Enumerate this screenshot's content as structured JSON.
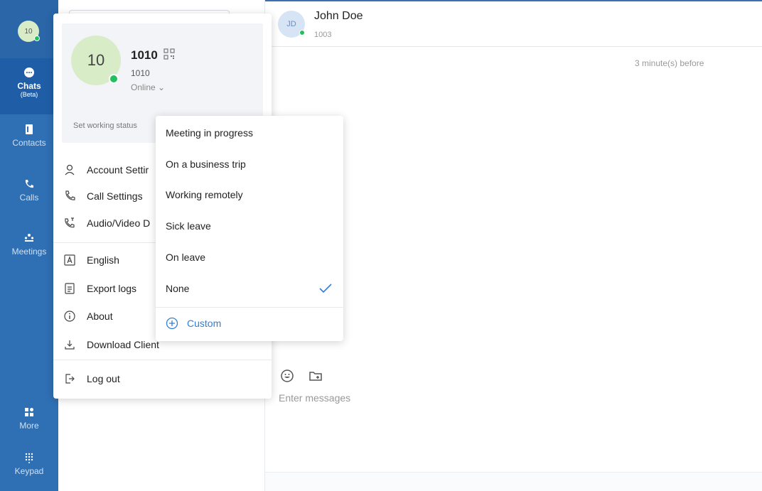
{
  "rail": {
    "avatar_initials": "10",
    "items": [
      {
        "label": "Chats",
        "sub": "(Beta)",
        "icon": "chat-bubble-icon"
      },
      {
        "label": "Contacts",
        "icon": "contacts-book-icon"
      },
      {
        "label": "Calls",
        "icon": "phone-icon"
      },
      {
        "label": "Meetings",
        "icon": "meeting-people-icon"
      },
      {
        "label": "More",
        "icon": "grid-more-icon"
      },
      {
        "label": "Keypad",
        "icon": "keypad-icon"
      }
    ]
  },
  "chat": {
    "contact_initials": "JD",
    "contact_name": "John Doe",
    "contact_ext": "1003",
    "timestamp": "3 minute(s) before",
    "input_placeholder": "Enter messages",
    "tools": [
      "emoji-icon",
      "attach-folder-icon"
    ]
  },
  "profile": {
    "avatar_initials": "10",
    "name": "1010",
    "extension": "1010",
    "presence": "Online ⌄",
    "working_status_label": "Set working status",
    "menu": [
      {
        "label": "Account Settir",
        "icon": "user-icon"
      },
      {
        "label": "Call Settings",
        "icon": "phone-icon"
      },
      {
        "label": "Audio/Video D",
        "icon": "phone-video-icon"
      },
      {
        "label": "English",
        "icon": "language-icon"
      },
      {
        "label": "Export logs",
        "icon": "document-icon"
      },
      {
        "label": "About",
        "icon": "info-icon"
      },
      {
        "label": "Download Client",
        "icon": "download-icon"
      },
      {
        "label": "Log out",
        "icon": "logout-icon"
      }
    ]
  },
  "status_menu": {
    "options": [
      "Meeting in progress",
      "On a business trip",
      "Working remotely",
      "Sick leave",
      "On leave",
      "None"
    ],
    "selected": "None",
    "custom_label": "Custom"
  },
  "colors": {
    "rail": "#2f6fb4",
    "accent": "#2f7fd8",
    "online": "#20c05c"
  }
}
